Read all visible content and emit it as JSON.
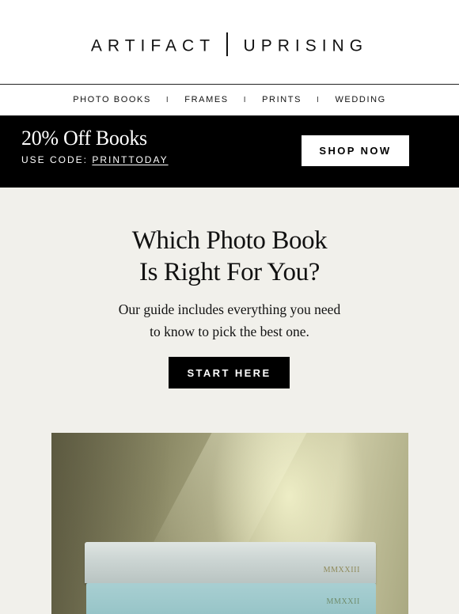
{
  "header": {
    "logo_left": "ARTIFACT",
    "logo_right": "UPRISING"
  },
  "nav": {
    "items": [
      "PHOTO BOOKS",
      "FRAMES",
      "PRINTS",
      "WEDDING"
    ],
    "separator": "I"
  },
  "promo": {
    "title": "20% Off Books",
    "code_label": "USE CODE:",
    "code": "PRINTTODAY",
    "button_label": "SHOP NOW"
  },
  "hero": {
    "heading_line1": "Which Photo Book",
    "heading_line2": "Is Right For You?",
    "body_line1": "Our guide includes everything you need",
    "body_line2": "to know to pick the best one.",
    "button_label": "START HERE"
  },
  "photo": {
    "book_top_label": "MMXXIII",
    "book_bottom_label": "MMXXII"
  },
  "colors": {
    "promo_bg": "#000000",
    "hero_bg": "#f1f0eb",
    "text": "#111111"
  }
}
